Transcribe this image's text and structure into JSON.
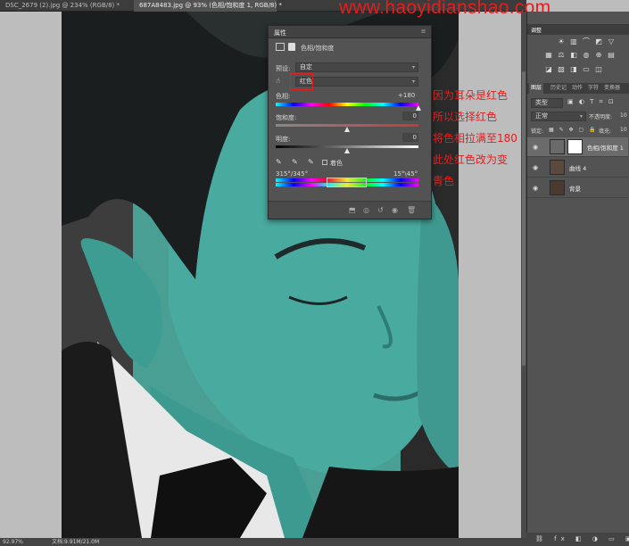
{
  "tabs": [
    {
      "label": "DSC_2679 (2).jpg @ 234% (RGB/8) *",
      "active": false
    },
    {
      "label": "687A8483.jpg @ 93% (色相/饱和度 1, RGB/8) *",
      "active": true
    }
  ],
  "watermark": "www.haoyidianshao.com",
  "properties": {
    "title": "属性",
    "adjustment_name": "色相/饱和度",
    "preset_label": "预设:",
    "preset_value": "自定",
    "channel_value": "红色",
    "hue_label": "色相:",
    "hue_value": "+180",
    "hue_fraction": 1.0,
    "saturation_label": "饱和度:",
    "saturation_value": "0",
    "saturation_fraction": 0.5,
    "lightness_label": "明度:",
    "lightness_value": "0",
    "lightness_fraction": 0.5,
    "colorize_label": "着色",
    "range_left": "315°/345°",
    "range_right": "15°\\45°"
  },
  "annotation": [
    "因为耳朵是红色",
    "所以选择红色",
    "将色相拉满至180",
    "此处红色改为变",
    "青色"
  ],
  "adjust_panel": {
    "title": "调整"
  },
  "layers_panel": {
    "tabs": [
      "图层",
      "历史记",
      "动作",
      "字符",
      "变换器"
    ],
    "kind_label": "类型",
    "blend_mode": "正常",
    "opacity_label": "不透明度:",
    "opacity_value": "10",
    "lock_label": "锁定:",
    "fill_label": "填充:",
    "fill_value": "10",
    "layers": [
      {
        "name": "色相/饱和度 1",
        "selected": true
      },
      {
        "name": "曲线 4",
        "selected": false
      },
      {
        "name": "背景",
        "selected": false
      }
    ]
  },
  "status": {
    "zoom": "92.97%",
    "doc": "文档:9.91M/21.0M"
  },
  "colors": {
    "annotation": "#e21f1f",
    "watermark": "#e21f1f",
    "skin": "#3fa398"
  }
}
